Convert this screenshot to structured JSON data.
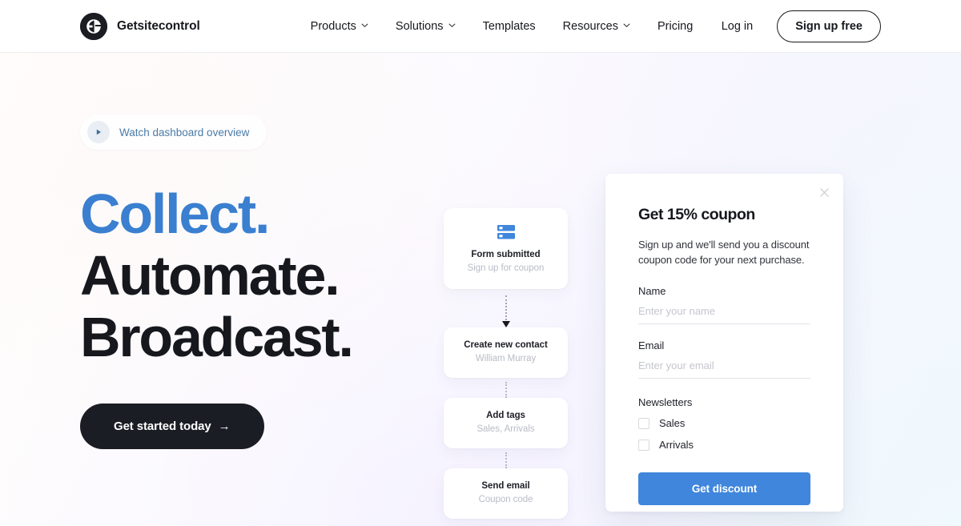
{
  "header": {
    "brand": {
      "name": "Getsitecontrol",
      "logo_icon": "getsitecontrol-logo-icon"
    },
    "nav": [
      {
        "label": "Products",
        "has_caret": true
      },
      {
        "label": "Solutions",
        "has_caret": true
      },
      {
        "label": "Templates",
        "has_caret": false
      },
      {
        "label": "Resources",
        "has_caret": true
      },
      {
        "label": "Pricing",
        "has_caret": false
      }
    ],
    "login_label": "Log in",
    "signup_label": "Sign up free"
  },
  "hero": {
    "watch_badge": {
      "label": "Watch dashboard overview",
      "icon": "play-icon"
    },
    "headline": {
      "line1": "Collect.",
      "line2": "Automate.",
      "line3": "Broadcast."
    },
    "cta": {
      "label": "Get started today",
      "arrow": "→"
    }
  },
  "flow": {
    "cards": [
      {
        "title": "Form submitted",
        "subtitle": "Sign up for coupon",
        "icon": "form-rows-icon"
      },
      {
        "title": "Create new contact",
        "subtitle": "William Murray",
        "icon": ""
      },
      {
        "title": "Add tags",
        "subtitle": "Sales, Arrivals",
        "icon": ""
      },
      {
        "title": "Send email",
        "subtitle": "Coupon code",
        "icon": ""
      }
    ]
  },
  "popup": {
    "close_icon": "close-icon",
    "title": "Get 15% coupon",
    "description": "Sign up and we'll send you a discount coupon code for your next purchase.",
    "fields": [
      {
        "label": "Name",
        "value": "",
        "placeholder": "Enter your name"
      },
      {
        "label": "Email",
        "value": "",
        "placeholder": "Enter your email"
      }
    ],
    "group_label": "Newsletters",
    "checkboxes": [
      {
        "label": "Sales",
        "checked": false
      },
      {
        "label": "Arrivals",
        "checked": false
      }
    ],
    "submit_label": "Get discount"
  },
  "colors": {
    "accent_blue": "#3a7fd0",
    "button_blue": "#3f86dc",
    "ink": "#16181d",
    "muted": "#b9bcc6",
    "watch_text": "#4a7ba8"
  }
}
